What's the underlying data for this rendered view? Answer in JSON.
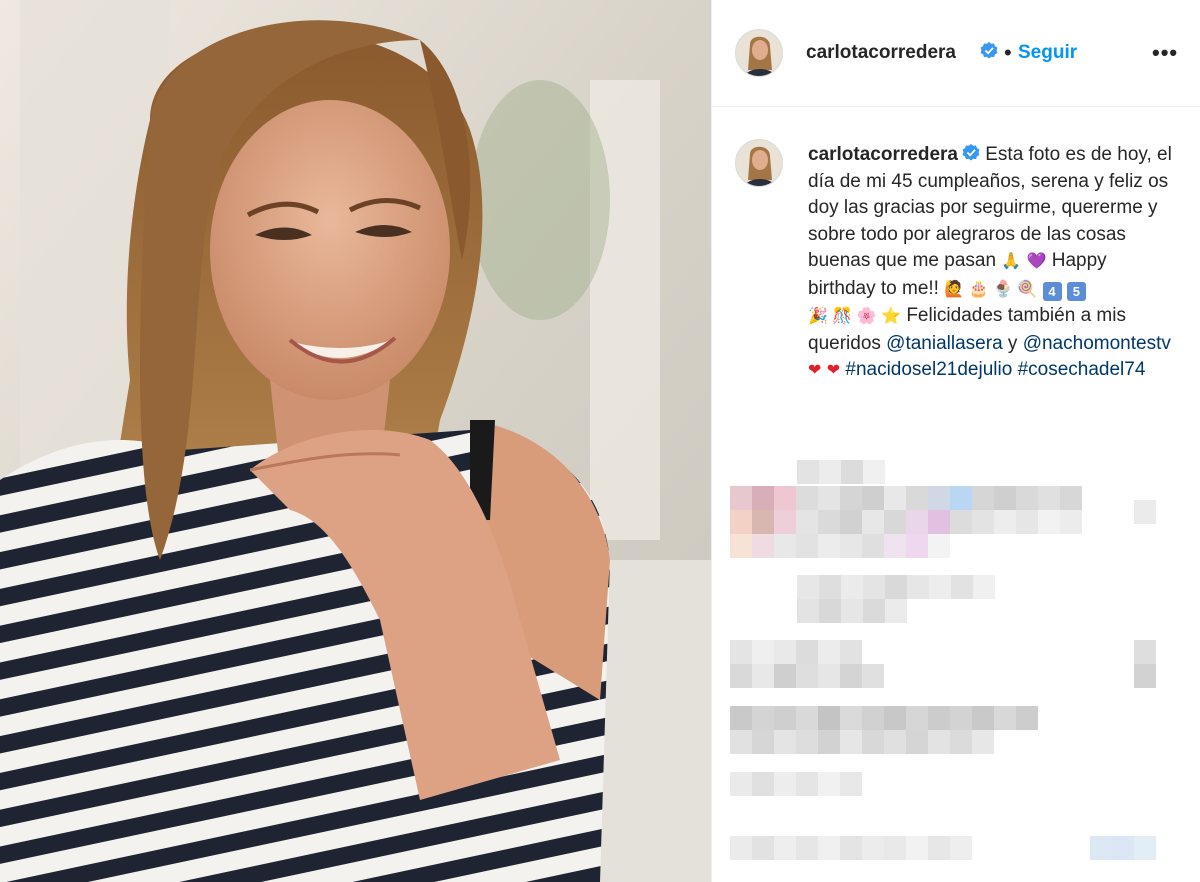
{
  "post": {
    "username": "carlotacorredera",
    "follow_label": "Seguir",
    "separator": "•",
    "more_label": "•••"
  },
  "caption": {
    "username": "carlotacorredera",
    "text_1": "Esta foto es de hoy, el día de mi 45 cumpleaños, serena y feliz os doy las gracias por seguirme, quererme y sobre todo por alegraros de las cosas buenas que me pasan",
    "emoji_pray": "🙏",
    "emoji_purple_heart": "💜",
    "text_2": "Happy birthday to me!!",
    "emoji_row": "🙋 🎂 🍨 🍭",
    "keycap_4": "4",
    "keycap_5": "5",
    "emoji_row_2": "🎉 🎊 🌸 ⭐",
    "text_3": "Felicidades también a mis queridos",
    "mention_1": "@taniallasera",
    "conj": "y",
    "mention_2": "@nachomontestv",
    "heart": "❤",
    "hashtag_1": "#nacidosel21dejulio",
    "hashtag_2": "#cosechadel74"
  },
  "colors": {
    "link": "#00376b",
    "follow": "#0095f6",
    "verified": "#3897f0",
    "text": "#262626"
  },
  "icons": {
    "verified": "verified-badge-icon",
    "more": "more-options-icon"
  }
}
